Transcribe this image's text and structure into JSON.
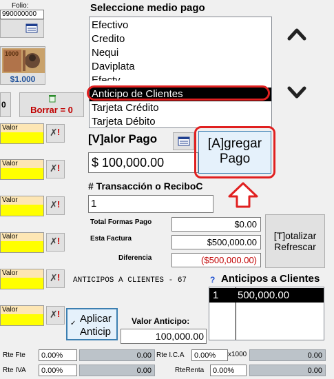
{
  "folio": {
    "label": "Folio:",
    "value": "990000000"
  },
  "banknote": {
    "price_label": "$1.000",
    "note_text": "1000"
  },
  "borrar_button": "Borrar = 0",
  "left_partial_zero": "0",
  "valor_blocks": [
    "Valor",
    "Valor",
    "Valor",
    "Valor",
    "Valor",
    "Valor"
  ],
  "medio_pago": {
    "title": "Seleccione medio pago",
    "items": [
      "Efectivo",
      "Credito",
      "Nequi",
      "Daviplata",
      "Efecty",
      "Anticipo de Clientes",
      "Tarjeta Crédito",
      "Tarjeta Débito"
    ],
    "selected": "Anticipo de Clientes"
  },
  "valor_pago": {
    "label": "[V]alor Pago",
    "value": "$ 100,000.00"
  },
  "agregar_pago_button": {
    "line1": "[A]gregar",
    "line2": "Pago"
  },
  "transaccion": {
    "label": "# Transacción o ReciboC",
    "value": "1"
  },
  "totals": {
    "total_formas_pago_label": "Total Formas Pago",
    "total_formas_pago_value": "$0.00",
    "esta_factura_label": "Esta Factura",
    "esta_factura_value": "$500,000.00",
    "diferencia_label": "Diferencia",
    "diferencia_value": "($500,000.00)"
  },
  "totalizar_button": {
    "line1": "[T]otalizar",
    "line2": "Refrescar"
  },
  "anticipos_count_text": "ANTICIPOS A CLIENTES - 67",
  "anticipos": {
    "help": "?",
    "title": "Anticipos a Clientes",
    "rows": [
      {
        "id": "1",
        "amount": "500,000.00"
      }
    ]
  },
  "aplicar_anticipo_button": {
    "line1": "Aplicar",
    "line2": "Anticip"
  },
  "valor_anticipo": {
    "label": "Valor Anticipo:",
    "value": "100,000.00"
  },
  "retenciones": {
    "rte_fte_label": "Rte Fte",
    "rte_fte_pct": "0.00%",
    "rte_fte_value": "0.00",
    "rte_ica_label": "Rte I.C.A",
    "rte_ica_pct": "0.00%",
    "x1000": "x1000",
    "rte_ica_value": "0.00",
    "rte_iva_label": "Rte IVA",
    "rte_iva_pct": "0.00%",
    "rte_iva_value": "0.00",
    "rte_renta_label": "RteRenta",
    "rte_renta_pct": "0.00%",
    "rte_renta_value": "0.00"
  },
  "colors": {
    "selection": "#000000",
    "highlight_ring": "#e02020",
    "arrow": "#e02020",
    "negative": "#c00000",
    "yellow": "#ffff00"
  }
}
